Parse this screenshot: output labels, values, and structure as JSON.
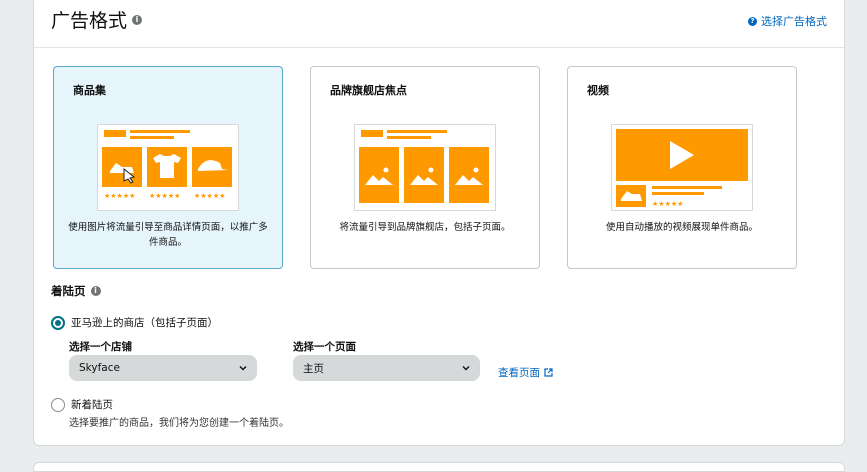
{
  "header": {
    "title": "广告格式",
    "help_link": "选择广告格式"
  },
  "cards": [
    {
      "title": "商品集",
      "description": "使用图片将流量引导至商品详情页面，以推广多件商品。",
      "selected": true
    },
    {
      "title": "品牌旗舰店焦点",
      "description": "将流量引导到品牌旗舰店，包括子页面。",
      "selected": false
    },
    {
      "title": "视频",
      "description": "使用自动播放的视频展现单件商品。",
      "selected": false
    }
  ],
  "landing": {
    "label": "着陆页",
    "option_store": "亚马逊上的商店（包括子页面）",
    "store_label": "选择一个店铺",
    "store_value": "Skyface",
    "page_label": "选择一个页面",
    "page_value": "主页",
    "view_page": "查看页面",
    "option_new": "新着陆页",
    "option_new_desc": "选择要推广的商品，我们将为您创建一个着陆页。"
  },
  "colors": {
    "accent": "#ff9900",
    "link": "#0066c0",
    "selected_bg": "#e6f4fb",
    "radio": "#007185"
  }
}
